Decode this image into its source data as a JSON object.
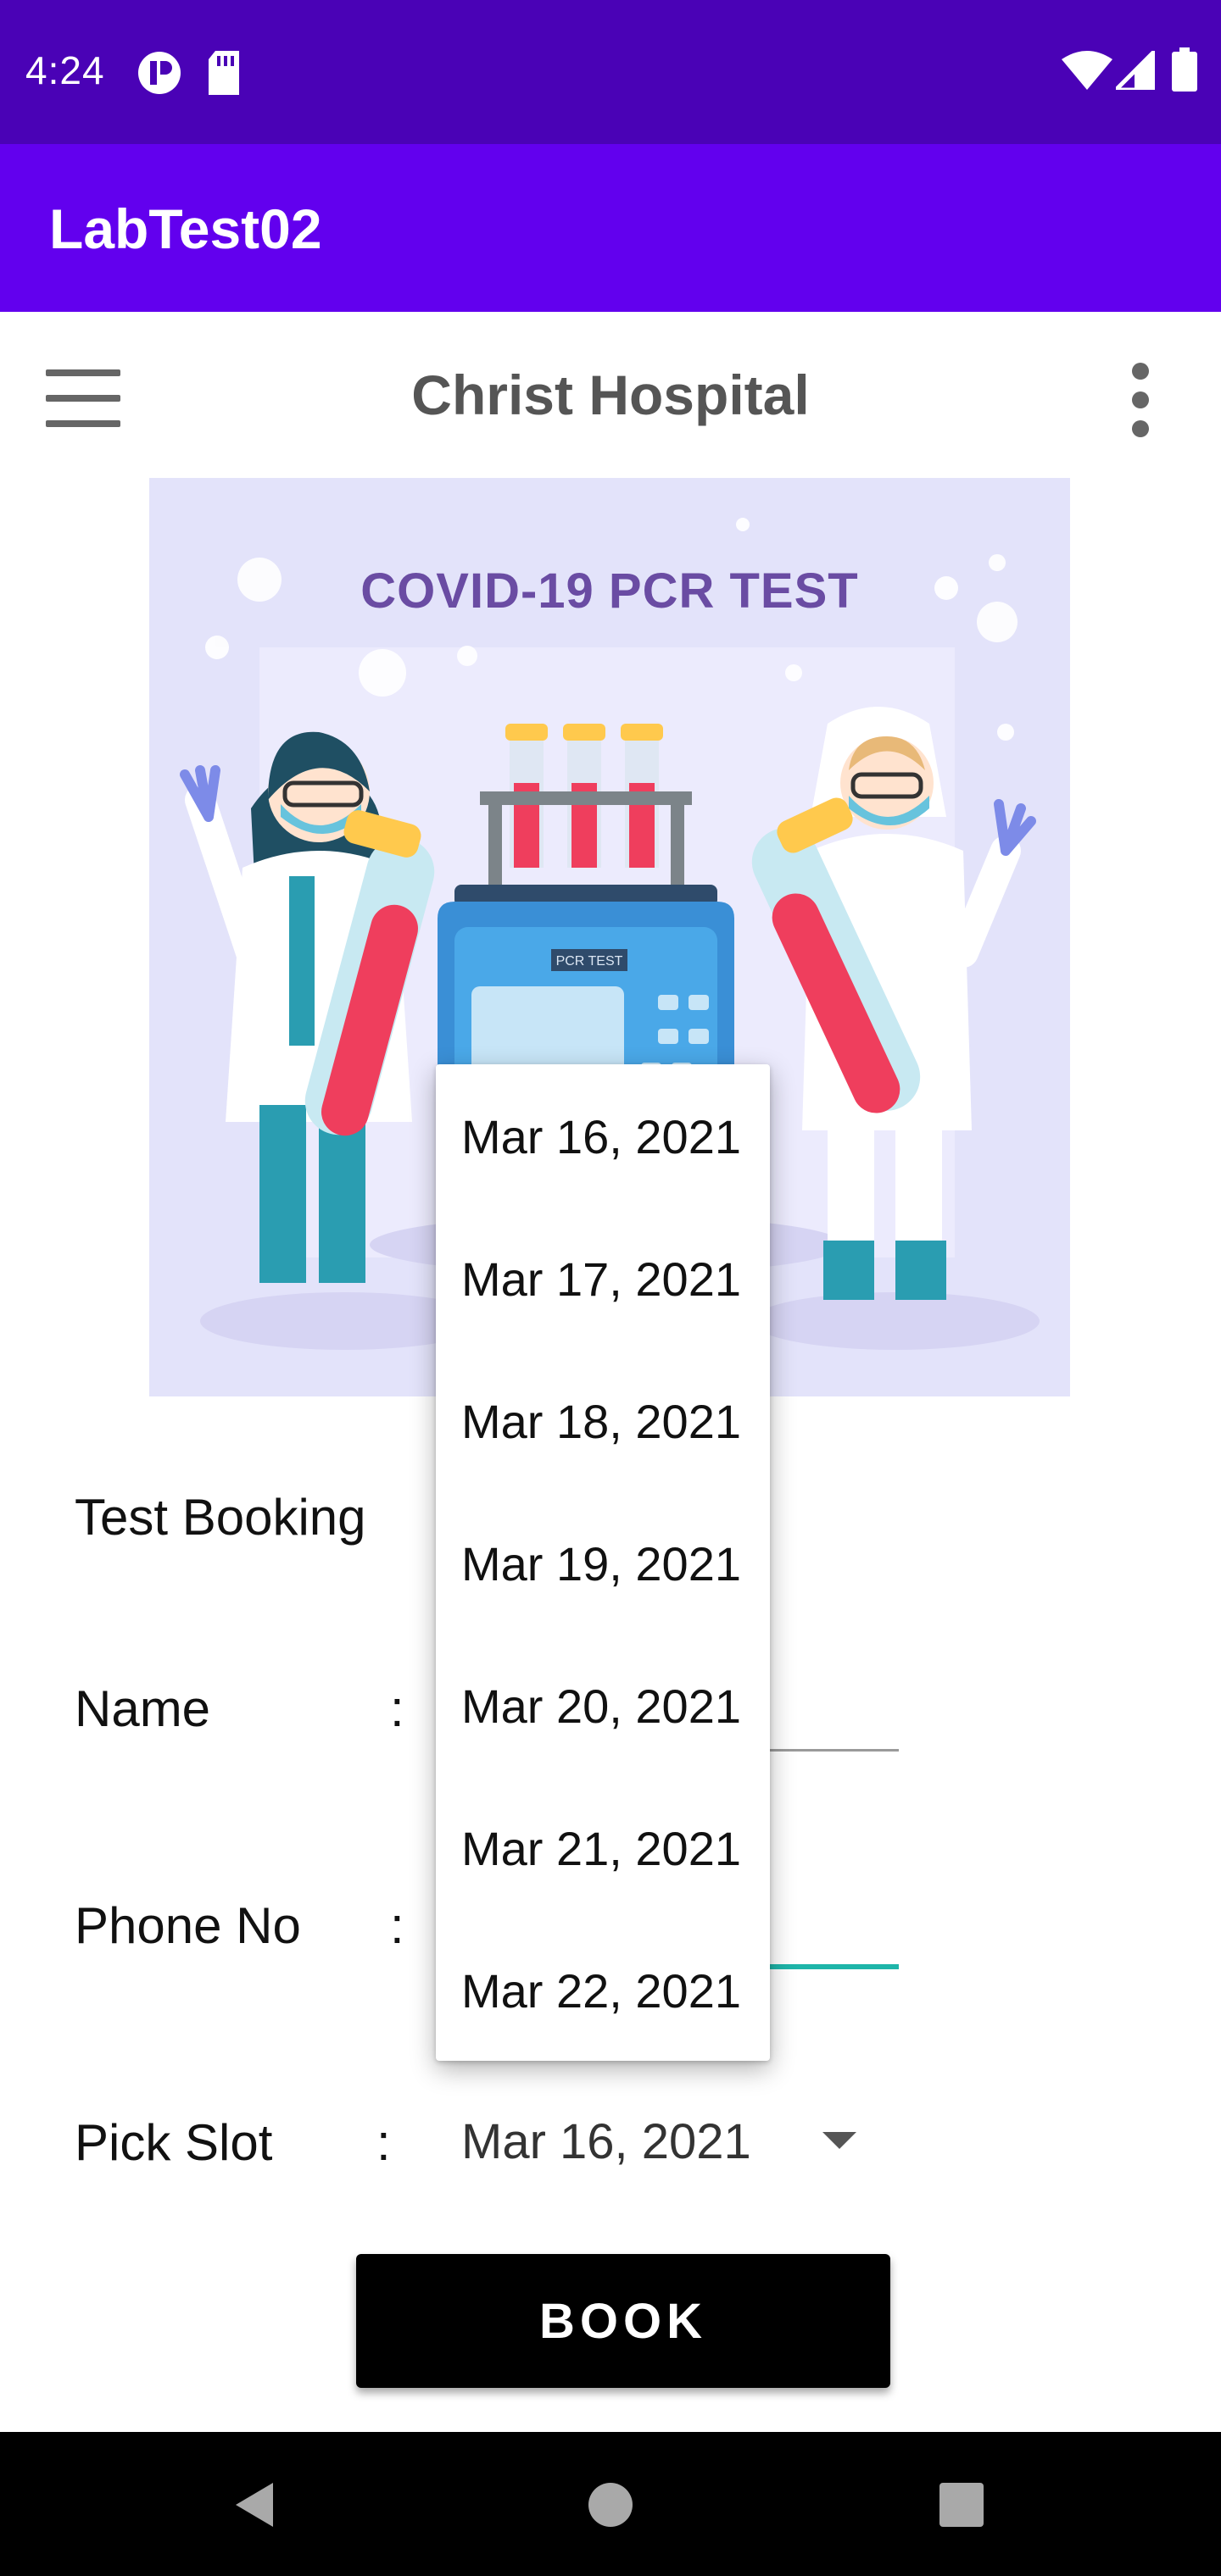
{
  "status_bar": {
    "time": "4:24"
  },
  "app_bar": {
    "title": "LabTest02"
  },
  "toolbar": {
    "title": "Christ Hospital"
  },
  "hero": {
    "title": "COVID-19 PCR TEST",
    "machine_label": "PCR TEST"
  },
  "form": {
    "section_title": "Test Booking",
    "name_label": "Name",
    "phone_label": "Phone No",
    "slot_label": "Pick Slot",
    "colon": ":",
    "slot_selected": "Mar 16, 2021"
  },
  "dropdown": {
    "options": [
      "Mar 16, 2021",
      "Mar 17, 2021",
      "Mar 18, 2021",
      "Mar 19, 2021",
      "Mar 20, 2021",
      "Mar 21, 2021",
      "Mar 22, 2021"
    ]
  },
  "book_button": {
    "label": "BOOK"
  },
  "colors": {
    "status_bar": "#4a02b6",
    "app_bar": "#6200ee",
    "accent": "#1eb5a9"
  }
}
